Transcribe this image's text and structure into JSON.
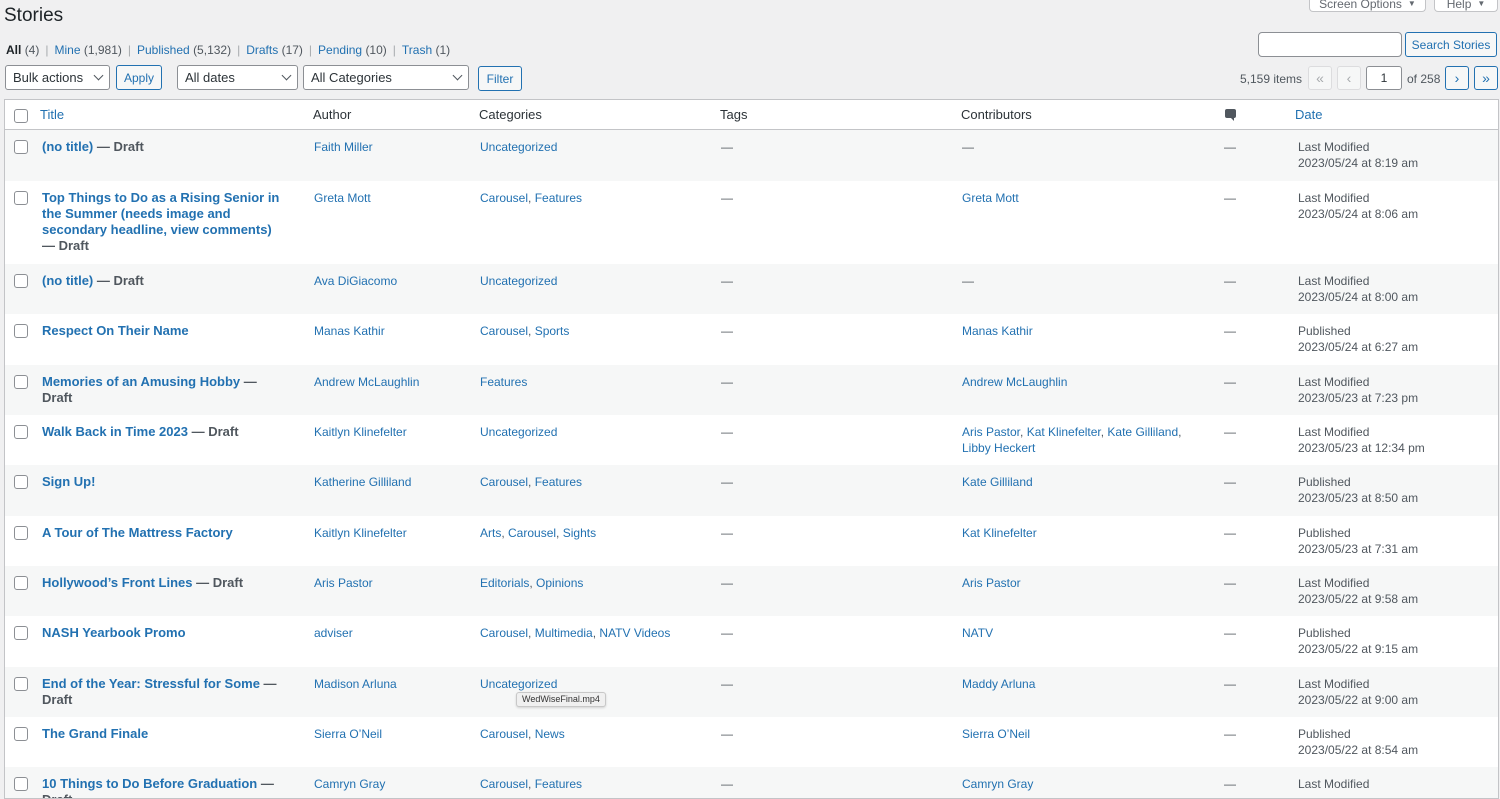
{
  "page": {
    "title": "Stories"
  },
  "top_tabs": {
    "screen_options": "Screen Options",
    "help": "Help"
  },
  "views": [
    {
      "label": "All",
      "count": "(4)",
      "current": true
    },
    {
      "label": "Mine",
      "count": "(1,981)"
    },
    {
      "label": "Published",
      "count": "(5,132)"
    },
    {
      "label": "Drafts",
      "count": "(17)"
    },
    {
      "label": "Pending",
      "count": "(10)"
    },
    {
      "label": "Trash",
      "count": "(1)"
    }
  ],
  "search": {
    "button": "Search Stories",
    "value": ""
  },
  "filters": {
    "bulk_actions": "Bulk actions",
    "apply": "Apply",
    "dates": "All dates",
    "categories": "All Categories",
    "filter": "Filter"
  },
  "pagination": {
    "items": "5,159 items",
    "first": "«",
    "prev": "‹",
    "current_page": "1",
    "of_total": "of 258",
    "next": "›",
    "last": "»"
  },
  "columns": {
    "title": "Title",
    "author": "Author",
    "categories": "Categories",
    "tags": "Tags",
    "contributors": "Contributors",
    "date": "Date"
  },
  "rows": [
    {
      "title": "(no title)",
      "state": " — Draft",
      "author": "Faith Miller",
      "categories": [
        "Uncategorized"
      ],
      "tags": "—",
      "contributors": [],
      "contributors_empty": "—",
      "comments": "—",
      "date_status": "Last Modified",
      "date": "2023/05/24 at 8:19 am"
    },
    {
      "title": "Top Things to Do as a Rising Senior in the Summer (needs image and secondary headline, view comments)",
      "state": " — Draft",
      "author": "Greta Mott",
      "categories": [
        "Carousel",
        "Features"
      ],
      "tags": "—",
      "contributors": [
        "Greta Mott"
      ],
      "comments": "—",
      "date_status": "Last Modified",
      "date": "2023/05/24 at 8:06 am"
    },
    {
      "title": "(no title)",
      "state": " — Draft",
      "author": "Ava DiGiacomo",
      "categories": [
        "Uncategorized"
      ],
      "tags": "—",
      "contributors": [],
      "contributors_empty": "—",
      "comments": "—",
      "date_status": "Last Modified",
      "date": "2023/05/24 at 8:00 am"
    },
    {
      "title": "Respect On Their Name",
      "state": "",
      "author": "Manas Kathir",
      "categories": [
        "Carousel",
        "Sports"
      ],
      "tags": "—",
      "contributors": [
        "Manas Kathir"
      ],
      "comments": "—",
      "date_status": "Published",
      "date": "2023/05/24 at 6:27 am"
    },
    {
      "title": "Memories of an Amusing Hobby",
      "state": " — Draft",
      "author": "Andrew McLaughlin",
      "categories": [
        "Features"
      ],
      "tags": "—",
      "contributors": [
        "Andrew McLaughlin"
      ],
      "comments": "—",
      "date_status": "Last Modified",
      "date": "2023/05/23 at 7:23 pm"
    },
    {
      "title": "Walk Back in Time 2023",
      "state": " — Draft",
      "author": "Kaitlyn Klinefelter",
      "categories": [
        "Uncategorized"
      ],
      "tags": "—",
      "contributors": [
        "Aris Pastor",
        "Kat Klinefelter",
        "Kate Gilliland",
        "Libby Heckert"
      ],
      "comments": "—",
      "date_status": "Last Modified",
      "date": "2023/05/23 at 12:34 pm"
    },
    {
      "title": "Sign Up!",
      "state": "",
      "author": "Katherine Gilliland",
      "categories": [
        "Carousel",
        "Features"
      ],
      "tags": "—",
      "contributors": [
        "Kate Gilliland"
      ],
      "comments": "—",
      "date_status": "Published",
      "date": "2023/05/23 at 8:50 am"
    },
    {
      "title": "A Tour of The Mattress Factory",
      "state": "",
      "author": "Kaitlyn Klinefelter",
      "categories": [
        "Arts",
        "Carousel",
        "Sights"
      ],
      "tags": "—",
      "contributors": [
        "Kat Klinefelter"
      ],
      "comments": "—",
      "date_status": "Published",
      "date": "2023/05/23 at 7:31 am"
    },
    {
      "title": "Hollywood’s Front Lines",
      "state": " — Draft",
      "author": "Aris Pastor",
      "categories": [
        "Editorials",
        "Opinions"
      ],
      "tags": "—",
      "contributors": [
        "Aris Pastor"
      ],
      "comments": "—",
      "date_status": "Last Modified",
      "date": "2023/05/22 at 9:58 am"
    },
    {
      "title": "NASH Yearbook Promo",
      "state": "",
      "author": "adviser",
      "categories": [
        "Carousel",
        "Multimedia",
        "NATV Videos"
      ],
      "tags": "—",
      "contributors": [
        "NATV"
      ],
      "comments": "—",
      "date_status": "Published",
      "date": "2023/05/22 at 9:15 am"
    },
    {
      "title": "End of the Year: Stressful for Some",
      "state": " — Draft",
      "author": "Madison Arluna",
      "categories": [
        "Uncategorized"
      ],
      "tags": "—",
      "contributors": [
        "Maddy Arluna"
      ],
      "comments": "—",
      "date_status": "Last Modified",
      "date": "2023/05/22 at 9:00 am"
    },
    {
      "title": "The Grand Finale",
      "state": "",
      "author": "Sierra O’Neil",
      "categories": [
        "Carousel",
        "News"
      ],
      "tags": "—",
      "contributors": [
        "Sierra O’Neil"
      ],
      "comments": "—",
      "date_status": "Published",
      "date": "2023/05/22 at 8:54 am"
    },
    {
      "title": "10 Things to Do Before Graduation",
      "state": " — Draft",
      "author": "Camryn Gray",
      "categories": [
        "Carousel",
        "Features"
      ],
      "tags": "—",
      "contributors": [
        "Camryn Gray"
      ],
      "comments": "—",
      "date_status": "Last Modified",
      "date": ""
    }
  ],
  "tooltip": "WedWiseFinal.mp4"
}
